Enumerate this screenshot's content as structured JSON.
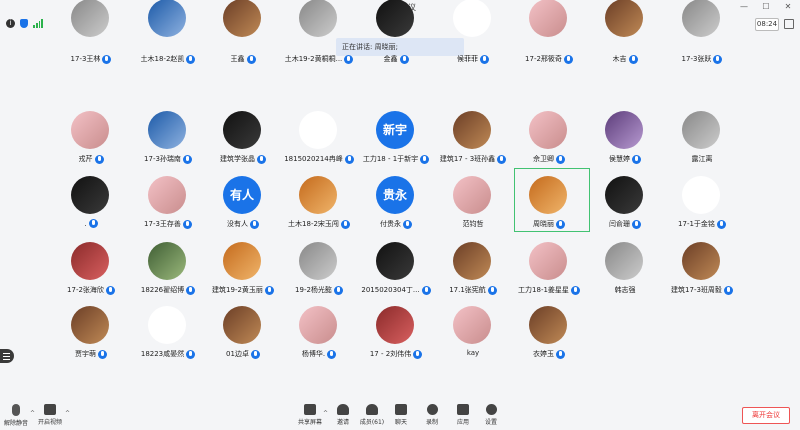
{
  "app": {
    "title": "腾讯会议",
    "time": "08:24"
  },
  "speaking_banner": "正在讲话: 周晓丽;",
  "colors": {
    "accent": "#1a73e8",
    "active_speaker_border": "#42c272",
    "leave": "#e33333"
  },
  "participants": [
    {
      "name": "17-3王林",
      "avatar_text": "",
      "pic": "pic-gray",
      "mic": true
    },
    {
      "name": "土木18-2赵凯",
      "avatar_text": "",
      "pic": "pic-blue",
      "mic": true
    },
    {
      "name": "王鑫",
      "avatar_text": "",
      "pic": "pic-brown",
      "mic": true
    },
    {
      "name": "土木19-2黄桐桐...",
      "avatar_text": "",
      "pic": "pic-gray",
      "mic": true
    },
    {
      "name": "金鑫",
      "avatar_text": "",
      "pic": "pic-dark",
      "mic": true
    },
    {
      "name": "候菲菲",
      "avatar_text": "",
      "pic": "pic-white",
      "mic": true
    },
    {
      "name": "17-2邢筱奇",
      "avatar_text": "",
      "pic": "pic-pink",
      "mic": true
    },
    {
      "name": "木吉",
      "avatar_text": "",
      "pic": "pic-brown",
      "mic": true
    },
    {
      "name": "17-3张跃",
      "avatar_text": "",
      "pic": "pic-gray",
      "mic": true
    },
    {
      "name": "戎芹",
      "avatar_text": "",
      "pic": "pic-pink",
      "mic": true
    },
    {
      "name": "17-3孙瑞南",
      "avatar_text": "",
      "pic": "pic-blue",
      "mic": true
    },
    {
      "name": "建筑学张晶",
      "avatar_text": "",
      "pic": "pic-dark",
      "mic": true
    },
    {
      "name": "1815020214冉峰",
      "avatar_text": "",
      "pic": "pic-white",
      "mic": true
    },
    {
      "name": "工力18 - 1于新宇",
      "avatar_text": "新宇",
      "pic": "pic-solidblue",
      "mic": true
    },
    {
      "name": "建筑17 - 3班孙鑫",
      "avatar_text": "",
      "pic": "pic-brown",
      "mic": true
    },
    {
      "name": "佘卫卿",
      "avatar_text": "",
      "pic": "pic-pink",
      "mic": true
    },
    {
      "name": "侯慧婷",
      "avatar_text": "",
      "pic": "pic-purple",
      "mic": true
    },
    {
      "name": "露江离",
      "avatar_text": "",
      "pic": "pic-gray",
      "mic": false
    },
    {
      "name": ".",
      "avatar_text": "",
      "pic": "pic-dark",
      "mic": true
    },
    {
      "name": "17-3王存善",
      "avatar_text": "",
      "pic": "pic-pink",
      "mic": true
    },
    {
      "name": "没有人",
      "avatar_text": "有人",
      "pic": "pic-solidblue",
      "mic": true
    },
    {
      "name": "土木18-2宋玉闯",
      "avatar_text": "",
      "pic": "pic-orange",
      "mic": true
    },
    {
      "name": "付贵永",
      "avatar_text": "贵永",
      "pic": "pic-solidblue",
      "mic": true
    },
    {
      "name": "范钧哲",
      "avatar_text": "",
      "pic": "pic-pink",
      "mic": false
    },
    {
      "name": "周晓丽",
      "avatar_text": "",
      "pic": "pic-orange",
      "mic": true
    },
    {
      "name": "闫俞珊",
      "avatar_text": "",
      "pic": "pic-dark",
      "mic": true
    },
    {
      "name": "17-1于金铭",
      "avatar_text": "",
      "pic": "pic-white",
      "mic": true
    },
    {
      "name": "17-2张海欣",
      "avatar_text": "",
      "pic": "pic-red",
      "mic": true
    },
    {
      "name": "18226翟绍博",
      "avatar_text": "",
      "pic": "pic-green",
      "mic": true
    },
    {
      "name": "建筑19-2黄玉丽",
      "avatar_text": "",
      "pic": "pic-orange",
      "mic": true
    },
    {
      "name": "19-2杨光懿",
      "avatar_text": "",
      "pic": "pic-gray",
      "mic": true
    },
    {
      "name": "2015020304丁...",
      "avatar_text": "",
      "pic": "pic-dark",
      "mic": true
    },
    {
      "name": "17.1张宪航",
      "avatar_text": "",
      "pic": "pic-brown",
      "mic": true
    },
    {
      "name": "工力18-1姜星星",
      "avatar_text": "",
      "pic": "pic-pink",
      "mic": true
    },
    {
      "name": "韩志强",
      "avatar_text": "",
      "pic": "pic-gray",
      "mic": false
    },
    {
      "name": "建筑17-3班周毅",
      "avatar_text": "",
      "pic": "pic-brown",
      "mic": true
    },
    {
      "name": "贾宇萌",
      "avatar_text": "",
      "pic": "pic-brown",
      "mic": true
    },
    {
      "name": "18223咸晏然",
      "avatar_text": "",
      "pic": "pic-white",
      "mic": true
    },
    {
      "name": "01边卓",
      "avatar_text": "",
      "pic": "pic-brown",
      "mic": true
    },
    {
      "name": "杨博华.",
      "avatar_text": "",
      "pic": "pic-pink",
      "mic": true
    },
    {
      "name": "17 - 2刘伟伟",
      "avatar_text": "",
      "pic": "pic-red",
      "mic": true
    },
    {
      "name": "kay",
      "avatar_text": "",
      "pic": "pic-pink",
      "mic": false
    },
    {
      "name": "衣婷玉",
      "avatar_text": "",
      "pic": "pic-brown",
      "mic": true
    }
  ],
  "toolbar": {
    "mute": "解除静音",
    "video": "开启视频",
    "share": "共享屏幕",
    "invite": "邀请",
    "members": "成员(61)",
    "chat": "聊天",
    "record": "录制",
    "apps": "应用",
    "settings": "设置",
    "leave": "离开会议"
  }
}
